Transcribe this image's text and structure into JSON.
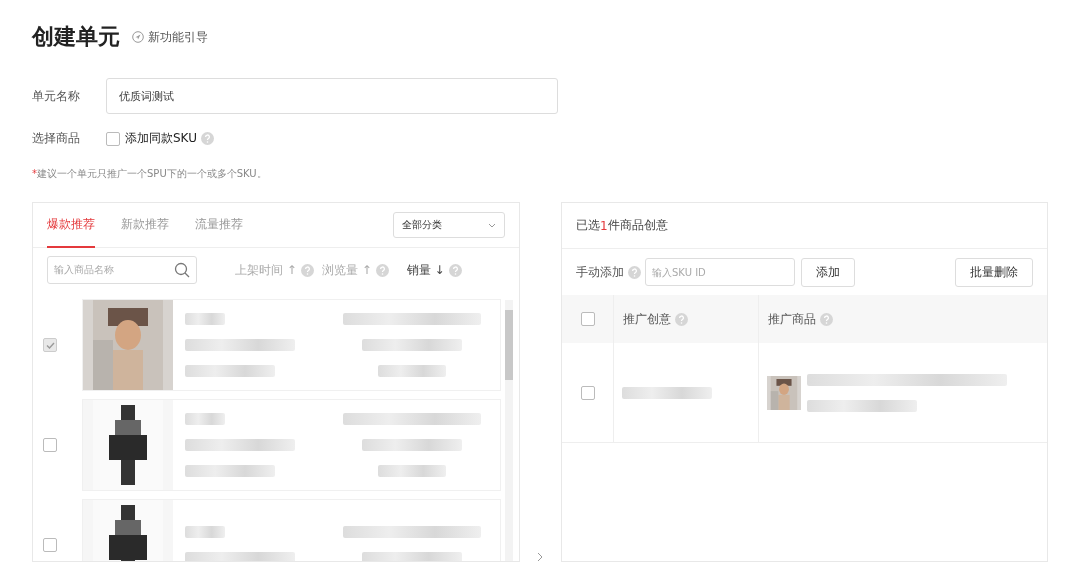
{
  "page": {
    "title": "创建单元",
    "guide_link": "新功能引导"
  },
  "form": {
    "unit_name": {
      "label": "单元名称",
      "value": "优质词测试"
    },
    "select_product": {
      "label": "选择商品",
      "option": {
        "label": "添加同款SKU",
        "checked": false
      }
    },
    "note": {
      "mark": "*",
      "text": "建议一个单元只推广一个SPU下的一个或多个SKU。"
    }
  },
  "product_picker": {
    "tabs": [
      {
        "label": "爆款推荐",
        "selected": true
      },
      {
        "label": "新款推荐",
        "selected": false
      },
      {
        "label": "流量推荐",
        "selected": false
      }
    ],
    "category": {
      "value": "全部分类"
    },
    "search": {
      "placeholder": "输入商品名称"
    },
    "sorts": [
      {
        "label": "上架时间 ↑",
        "active": false
      },
      {
        "label": "浏览量 ↑",
        "active": false
      },
      {
        "label": "销量 ↓",
        "active": true
      }
    ],
    "products": [
      {
        "checked": true,
        "disabled": true,
        "kind": "picture"
      },
      {
        "checked": false,
        "disabled": false,
        "kind": "picture"
      },
      {
        "checked": false,
        "disabled": false,
        "kind": "picture"
      }
    ]
  },
  "selected_panel": {
    "summary": {
      "prefix": "已选",
      "count": "1",
      "suffix": "件商品创意"
    },
    "manual_add": {
      "label": "手动添加",
      "placeholder": "输入SKU ID",
      "add_button": "添加"
    },
    "bulk_delete": "批量删除",
    "table": {
      "columns": [
        "推广创意",
        "推广商品"
      ],
      "all_checked": false,
      "rows": [
        {
          "checked": false
        }
      ]
    }
  }
}
